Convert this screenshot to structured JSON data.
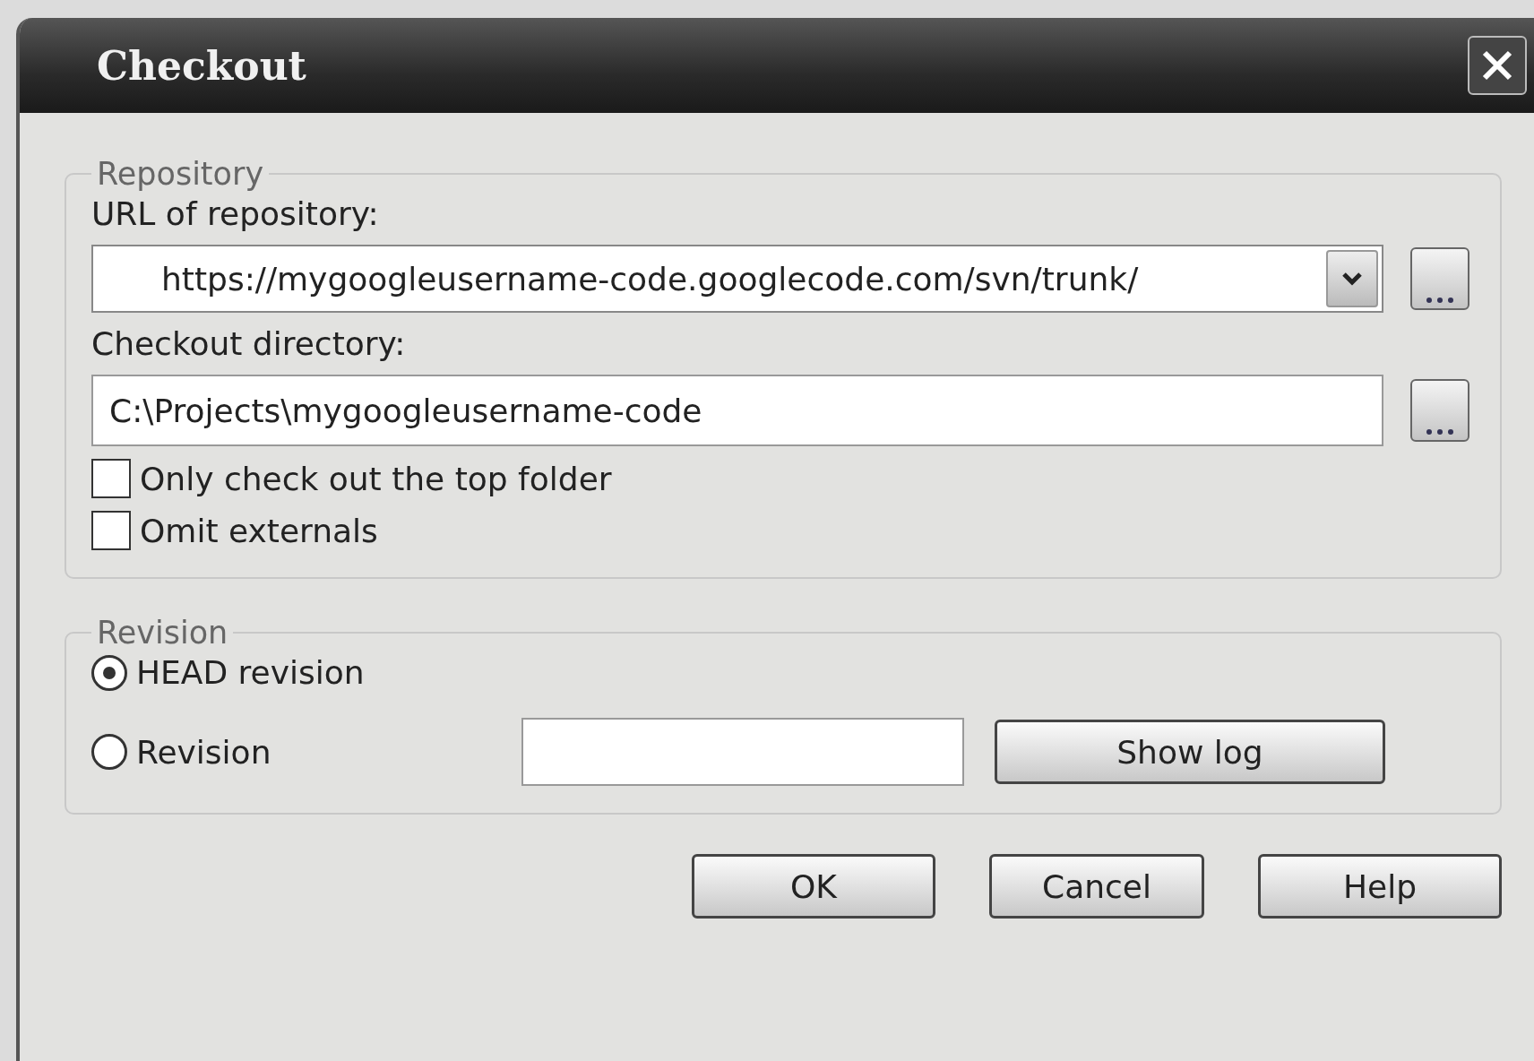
{
  "window": {
    "title": "Checkout"
  },
  "repository": {
    "legend": "Repository",
    "url_label": "URL of repository:",
    "url_value": "https://mygoogleusername-code.googlecode.com/svn/trunk/",
    "dir_label": "Checkout directory:",
    "dir_value": "C:\\Projects\\mygoogleusername-code",
    "options": [
      {
        "label": "Only check out the top folder",
        "checked": false
      },
      {
        "label": "Omit externals",
        "checked": false
      }
    ]
  },
  "revision": {
    "legend": "Revision",
    "choices": [
      {
        "label": "HEAD revision",
        "selected": true
      },
      {
        "label": "Revision",
        "selected": false
      }
    ],
    "show_log": "Show log"
  },
  "buttons": [
    "OK",
    "Cancel",
    "Help"
  ]
}
